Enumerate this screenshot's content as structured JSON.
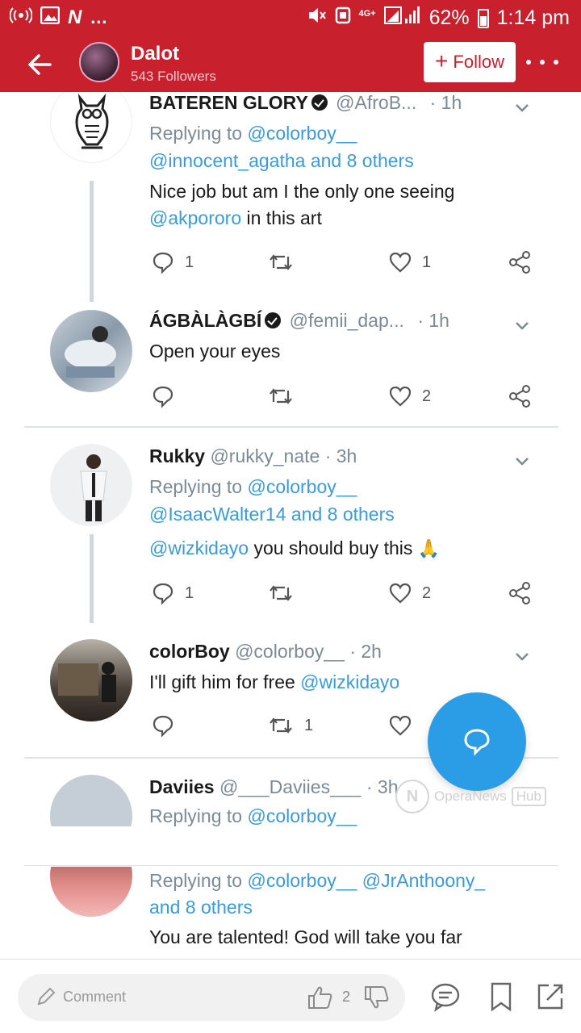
{
  "status_bar": {
    "network": "4G+",
    "battery": "62%",
    "time": "1:14 pm"
  },
  "header": {
    "name": "Dalot",
    "followers": "543 Followers",
    "follow_label": "Follow"
  },
  "tweets": [
    {
      "name": "BATEREN GLORY",
      "handle": "@AfroB...",
      "time": "· 1h",
      "replying_prefix": "Replying to",
      "replying_to": "@colorboy__",
      "replying_more": "@innocent_agatha and 8 others",
      "text_line1": "Nice job but am I the only one seeing",
      "text_mention": "@akpororo",
      "text_line2_rest": " in this art",
      "replies": "1",
      "retweets": "",
      "likes": "1"
    },
    {
      "name": "ÁGBÀLÀGBÍ",
      "handle": "@femii_dap...",
      "time": "· 1h",
      "text": "Open your eyes",
      "replies": "",
      "retweets": "",
      "likes": "2"
    },
    {
      "name": "Rukky",
      "handle": "@rukky_nate",
      "time": "· 3h",
      "replying_prefix": "Replying to",
      "replying_to": "@colorboy__",
      "replying_more": "@IsaacWalter14 and 8 others",
      "text_mention": "@wizkidayo",
      "text_rest": " you should buy this",
      "emoji": "🙏",
      "replies": "1",
      "retweets": "",
      "likes": "2"
    },
    {
      "name": "colorBoy",
      "handle": "@colorboy__",
      "time": "· 2h",
      "text": "I'll gift him for free",
      "text_mention": "@wizkidayo",
      "replies": "",
      "retweets": "1",
      "likes": ""
    },
    {
      "name": "Daviies",
      "handle": "@___Daviies___",
      "time": "· 3h",
      "replying_prefix": "Replying to",
      "replying_to": "@colorboy__"
    },
    {
      "replying_prefix": "Replying to",
      "replying_to": "@colorboy__",
      "replying_extra": "@JrAnthoony_",
      "replying_more": "and 8 others",
      "text": "You are talented! God will take you far"
    }
  ],
  "watermark": {
    "text": "OperaNews",
    "hub": "Hub"
  },
  "bottom_bar": {
    "comment_placeholder": "Comment",
    "like_count": "2"
  },
  "colors": {
    "brand_red": "#c9202d",
    "link_blue": "#3a9bd8",
    "fab_blue": "#2b9de6"
  }
}
